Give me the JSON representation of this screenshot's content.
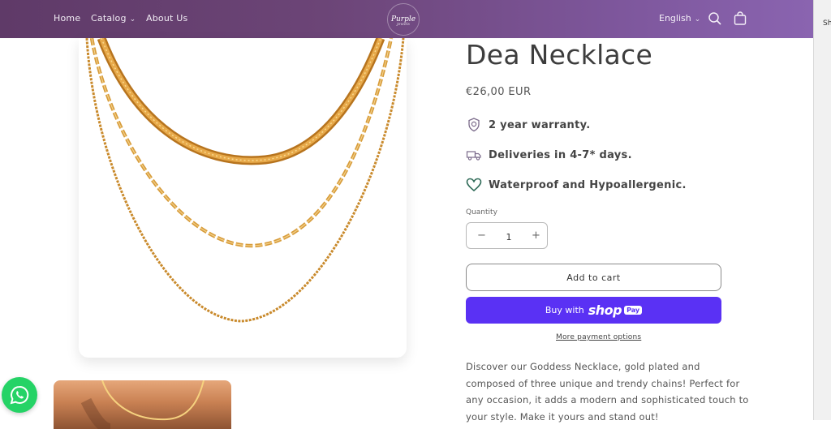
{
  "header": {
    "nav": [
      {
        "label": "Home"
      },
      {
        "label": "Catalog"
      },
      {
        "label": "About Us"
      }
    ],
    "logo_text": "Purple",
    "logo_sub": "jewels",
    "language": "English"
  },
  "strip_text": "Sh",
  "product": {
    "title": "Dea Necklace",
    "price": "€26,00 EUR",
    "features": [
      {
        "icon": "warranty-badge-icon",
        "text": "2 year warranty."
      },
      {
        "icon": "delivery-truck-icon",
        "text": "Deliveries in 4-7* days."
      },
      {
        "icon": "heart-icon",
        "text": "Waterproof and Hypoallergenic."
      }
    ],
    "quantity_label": "Quantity",
    "quantity": "1",
    "add_to_cart": "Add to cart",
    "shop_pay": {
      "buy_with": "Buy with",
      "brand": "shop",
      "pay": "Pay"
    },
    "more_payment": "More payment options",
    "description": "Discover our Goddess Necklace, gold plated and composed of three unique and trendy chains! Perfect for any occasion, it adds a modern and sophisticated touch to your style. Make it yours and stand out!"
  },
  "colors": {
    "header_start": "#5f3a68",
    "header_end": "#8a64b0",
    "shop_pay": "#5a31f4",
    "whatsapp": "#25d366",
    "gold": "#d9a443"
  }
}
